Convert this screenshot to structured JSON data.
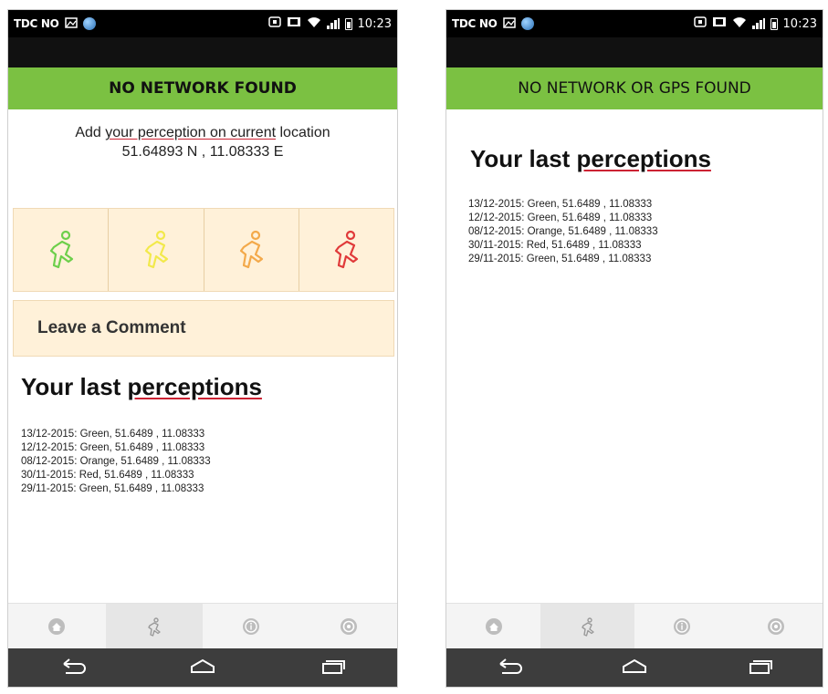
{
  "status_bar": {
    "carrier": "TDC NO",
    "time": "10:23"
  },
  "left": {
    "network_banner": "NO NETWORK FOUND",
    "location": {
      "prompt_part1": "Add ",
      "prompt_link": "your perception on current",
      "prompt_part2": " location",
      "coords": "51.64893 N , 11.08333 E"
    },
    "mood_buttons": [
      {
        "color": "#6ccf4a",
        "icon": "runner-green-icon"
      },
      {
        "color": "#f2e94b",
        "icon": "runner-yellow-icon"
      },
      {
        "color": "#f3a94a",
        "icon": "runner-orange-icon"
      },
      {
        "color": "#e03a3a",
        "icon": "runner-red-icon"
      }
    ],
    "comment_label": "Leave a Comment",
    "heading_part1": "Your last ",
    "heading_part2": "perceptions",
    "perceptions": [
      "13/12-2015: Green, 51.6489 , 11.08333",
      "12/12-2015: Green, 51.6489 , 11.08333",
      "08/12-2015: Orange, 51.6489 , 11.08333",
      "30/11-2015: Red, 51.6489 , 11.08333",
      "29/11-2015: Green, 51.6489 , 11.08333"
    ]
  },
  "right": {
    "network_banner": "NO NETWORK OR GPS FOUND",
    "heading_part1": "Your last ",
    "heading_part2": "perceptions",
    "perceptions": [
      "13/12-2015: Green, 51.6489 , 11.08333",
      "12/12-2015: Green, 51.6489 , 11.08333",
      "08/12-2015: Orange, 51.6489 , 11.08333",
      "30/11-2015: Red, 51.6489 , 11.08333",
      "29/11-2015: Green, 51.6489 , 11.08333"
    ]
  },
  "tabs": [
    {
      "icon": "home-icon",
      "active": false
    },
    {
      "icon": "runner-icon",
      "active": true
    },
    {
      "icon": "info-icon",
      "active": false
    },
    {
      "icon": "settings-icon",
      "active": false
    }
  ],
  "nav": [
    "back-icon",
    "home-nav-icon",
    "recent-apps-icon"
  ]
}
